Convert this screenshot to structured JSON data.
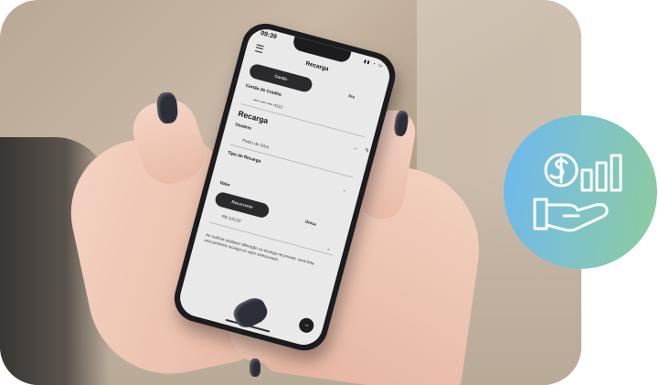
{
  "phone": {
    "status_time": "09:39",
    "app_title": "Recarga",
    "payment_tabs": {
      "active": "Cartão",
      "inactive": "Pix"
    },
    "card_label": "Cartão de Crédito",
    "card_number": "•••• •••• •••• 4212",
    "section_title": "Recarga",
    "user_label": "Usuário",
    "user_value": "Pedro de Silva",
    "type_label": "Tipo de Recarga",
    "type_tabs": {
      "active": "Recorrente",
      "inactive": "Única"
    },
    "value_label": "Valor",
    "value_amount": "R$ 100,00",
    "note": "Ao realizar qualquer alteração na recarga recorrente, será feita uma primeira recarga no valor selecionado.",
    "fab_icon": "arrow-right-icon"
  },
  "badge": {
    "icon": "money-growth-hand-icon",
    "gradient": [
      "#6bb8f0",
      "#8ccb9c"
    ]
  }
}
